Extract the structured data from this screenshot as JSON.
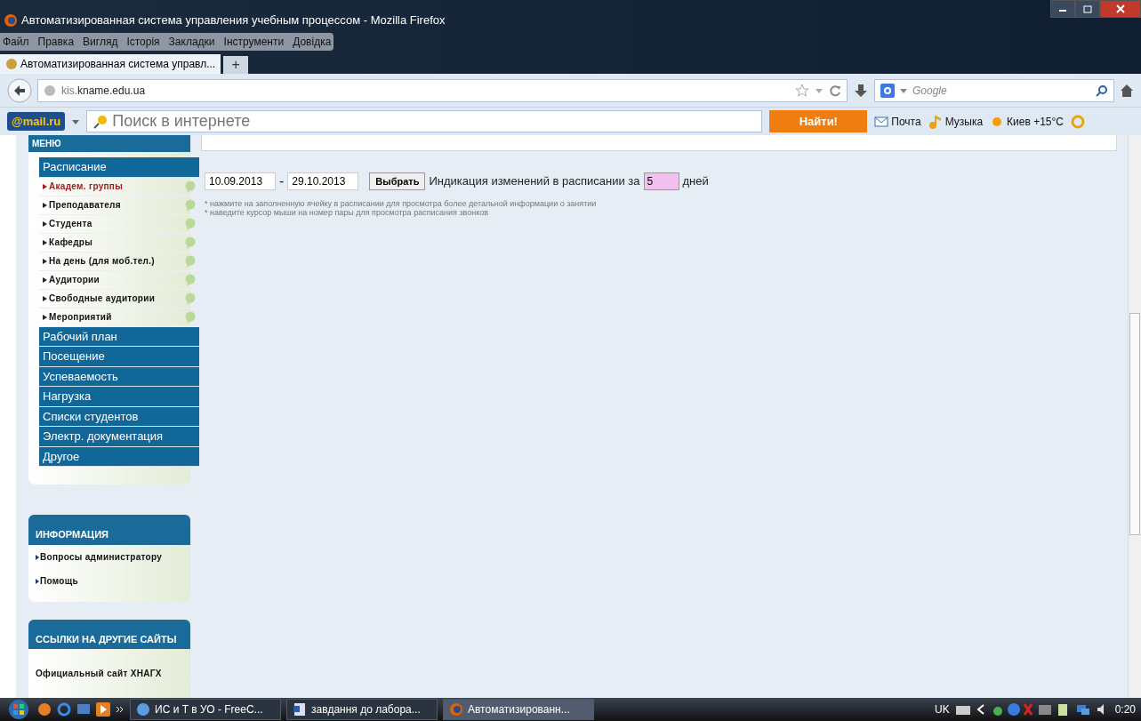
{
  "window": {
    "title": "Автоматизированная система управления учебным процессом - Mozilla Firefox"
  },
  "menu_bar": [
    "Файл",
    "Правка",
    "Вигляд",
    "Історія",
    "Закладки",
    "Інструменти",
    "Довідка"
  ],
  "tabs": [
    {
      "label": "Автоматизированная система управл...",
      "selected": true
    },
    {
      "label": "+",
      "selected": false
    }
  ],
  "address_bar": {
    "prefix": "kis.",
    "domain": "kname.edu.ua"
  },
  "search_engine": {
    "placeholder": "Google"
  },
  "mail_toolbar": {
    "logo": "@mail.ru",
    "search_placeholder": "Поиск в интернете",
    "search_button": "Найти!",
    "links": [
      "Почта",
      "Музыка",
      "Киев +15°C"
    ]
  },
  "sidebar": {
    "menu_title": "МЕНЮ",
    "sections": [
      {
        "label": "Расписание",
        "children": [
          {
            "label": "Академ. группы",
            "selected": true
          },
          {
            "label": "Преподавателя",
            "selected": false
          },
          {
            "label": "Студента",
            "selected": false
          },
          {
            "label": "Кафедры",
            "selected": false
          },
          {
            "label": "На день (для моб.тел.)",
            "selected": false
          },
          {
            "label": "Аудитории",
            "selected": false
          },
          {
            "label": "Свободные аудитории",
            "selected": false
          },
          {
            "label": "Мероприятий",
            "selected": false
          }
        ]
      },
      {
        "label": "Рабочий план"
      },
      {
        "label": "Посещение"
      },
      {
        "label": "Успеваемость"
      },
      {
        "label": "Нагрузка"
      },
      {
        "label": "Списки студентов"
      },
      {
        "label": "Электр. документация"
      },
      {
        "label": "Другое"
      }
    ],
    "info_title": "ИНФОРМАЦИЯ",
    "info_links": [
      "Вопросы администратору",
      "Помощь"
    ],
    "links_title": "ССЫЛКИ НА ДРУГИЕ САЙТЫ",
    "links": [
      "Официальный сайт ХНАГХ"
    ]
  },
  "filter": {
    "date_from": "10.09.2013",
    "date_to": "29.10.2013",
    "separator": "-",
    "button": "Выбрать",
    "indication_label": "Индикация изменений в расписании за",
    "days": "5",
    "days_unit": "дней"
  },
  "notes": [
    "* нажмите на заполненную ячейку в расписании для просмотра более детальной информации о занятии",
    "* наведите курсор мыши на номер пары для просмотра расписания звонков"
  ],
  "taskbar": {
    "windows": [
      {
        "label": "ИС и Т  в УО - FreeC...",
        "selected": false
      },
      {
        "label": "завдання до лабора...",
        "selected": false
      },
      {
        "label": "Автоматизированн...",
        "selected": true
      }
    ],
    "language": "UK",
    "clock": "0:20"
  }
}
